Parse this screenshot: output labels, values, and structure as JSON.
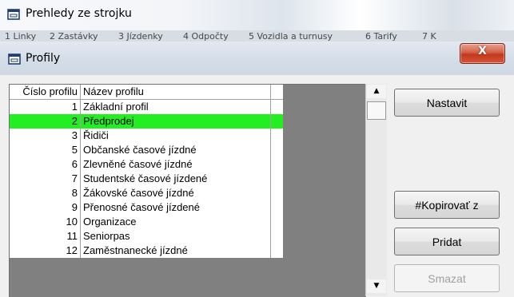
{
  "parent_window": {
    "title": "Prehledy ze strojku",
    "icon": "window-icon"
  },
  "parent_menu": [
    "1 Linky",
    "2 Zastávky",
    "3 Jízdenky",
    "4 Odpočty",
    "5 Vozidla a turnusy",
    "6 Tarify",
    "7 K"
  ],
  "dialog": {
    "title": "Profily",
    "icon": "window-icon",
    "close_label": "X"
  },
  "table": {
    "columns": [
      "Číslo profilu",
      "Název profilu"
    ],
    "rows": [
      {
        "number": "1",
        "name": "Základní profil"
      },
      {
        "number": "2",
        "name": "Předprodej"
      },
      {
        "number": "3",
        "name": "Řidiči"
      },
      {
        "number": "5",
        "name": "Občanské časové jízdné"
      },
      {
        "number": "6",
        "name": "Zlevněné časové jízdné"
      },
      {
        "number": "7",
        "name": "Studentské časové jízdené"
      },
      {
        "number": "8",
        "name": "Žákovské časové jízdné"
      },
      {
        "number": "9",
        "name": "Přenosné časové jízdené"
      },
      {
        "number": "10",
        "name": "Organizace"
      },
      {
        "number": "11",
        "name": "Seniorpas"
      },
      {
        "number": "12",
        "name": "Zaměstnanecké jízdné"
      }
    ],
    "selected_row": 1,
    "selection_color": "#22ee22"
  },
  "buttons": {
    "nastavit": "Nastavit",
    "kopirovat": "#Kopirovať z",
    "pridat": "Pridat",
    "smazat": "Smazat"
  }
}
